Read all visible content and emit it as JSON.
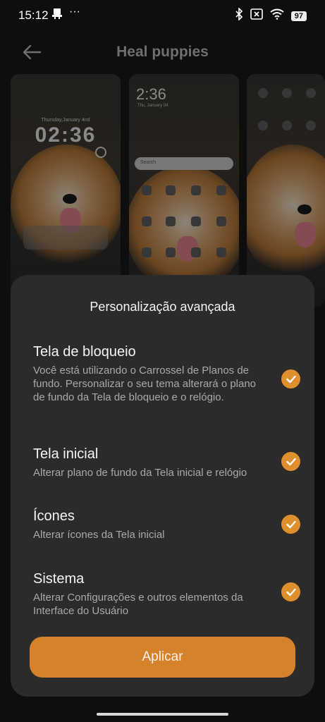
{
  "status_bar": {
    "time": "15:12",
    "battery": "97"
  },
  "header": {
    "title": "Heal puppies"
  },
  "previews": {
    "lock": {
      "date": "Thursday,January 4nd",
      "clock": "02:36"
    },
    "home": {
      "clock": "2:36",
      "date": "Thu, January 04",
      "search": "Search"
    }
  },
  "sheet": {
    "title": "Personalização avançada",
    "options": [
      {
        "title": "Tela de bloqueio",
        "description": "Você está utilizando o Carrossel de Planos de fundo. Personalizar o seu tema alterará o plano de fundo da Tela de bloqueio e o relógio.",
        "checked": true
      },
      {
        "title": "Tela inicial",
        "description": "Alterar plano de fundo da Tela inicial e relógio",
        "checked": true
      },
      {
        "title": "Ícones",
        "description": "Alterar ícones da Tela inicial",
        "checked": true
      },
      {
        "title": "Sistema",
        "description": "Alterar Configurações e outros elementos da Interface do Usuário",
        "checked": true
      }
    ],
    "apply_label": "Aplicar"
  },
  "colors": {
    "accent": "#d5822b",
    "check": "#e08f2f",
    "sheet_bg": "#2b2b2b",
    "page_bg": "#0e0e0e"
  }
}
